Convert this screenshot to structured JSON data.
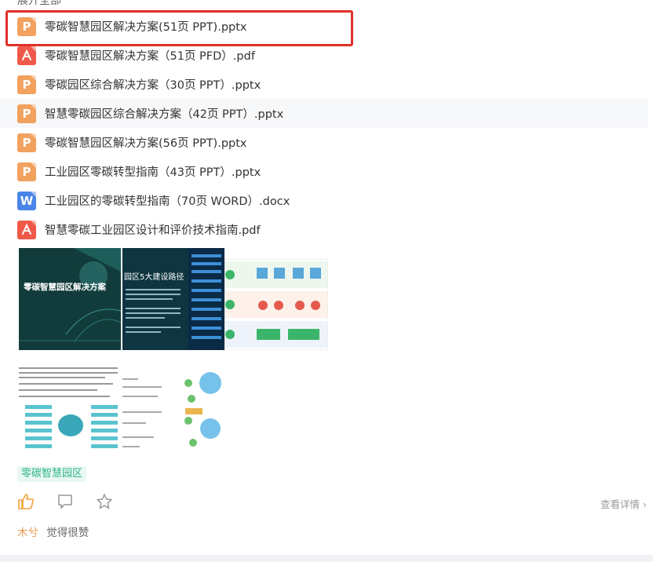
{
  "header": {
    "expand_all": "展开全部"
  },
  "files": [
    {
      "type": "ppt",
      "icon": "ppt-icon",
      "icon_letter": "P",
      "name": "零碳智慧园区解决方案(51页 PPT).pptx"
    },
    {
      "type": "pdf",
      "icon": "pdf-icon",
      "icon_letter": "",
      "name": "零碳智慧园区解决方案（51页 PFD）.pdf"
    },
    {
      "type": "ppt",
      "icon": "ppt-icon",
      "icon_letter": "P",
      "name": "零碳园区综合解决方案（30页 PPT）.pptx"
    },
    {
      "type": "ppt",
      "icon": "ppt-icon",
      "icon_letter": "P",
      "name": "智慧零碳园区综合解决方案（42页 PPT）.pptx"
    },
    {
      "type": "ppt",
      "icon": "ppt-icon",
      "icon_letter": "P",
      "name": "零碳智慧园区解决方案(56页 PPT).pptx"
    },
    {
      "type": "ppt",
      "icon": "ppt-icon",
      "icon_letter": "P",
      "name": "工业园区零碳转型指南（43页 PPT）.pptx"
    },
    {
      "type": "word",
      "icon": "word-icon",
      "icon_letter": "W",
      "name": "工业园区的零碳转型指南（70页 WORD）.docx"
    },
    {
      "type": "pdf",
      "icon": "pdf-icon",
      "icon_letter": "",
      "name": "智慧零碳工业园区设计和评价技术指南.pdf"
    }
  ],
  "thumbnails": {
    "t1_title": "零碳智慧园区解决方案",
    "t2_title": "园区5大建设路径"
  },
  "tag": "零碳智慧园区",
  "actions": {
    "like_icon": "thumbs-up-icon",
    "comment_icon": "comment-icon",
    "star_icon": "star-icon",
    "detail_link": "查看详情"
  },
  "comment": {
    "user": "木兮",
    "text": "觉得很赞"
  },
  "colors": {
    "highlight": "#e0302b",
    "ppt": "#f2a15f",
    "pdf": "#f0594a",
    "word": "#4a86e8",
    "tag": "#2fb583",
    "accent": "#f0a23a"
  }
}
